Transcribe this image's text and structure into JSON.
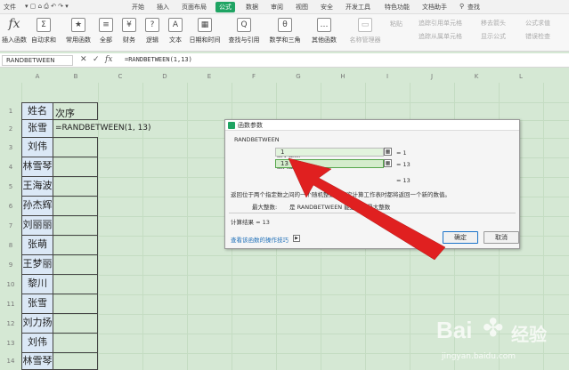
{
  "menu": {
    "file": "文件",
    "items": [
      "开始",
      "插入",
      "页面布局",
      "公式",
      "数据",
      "审阅",
      "视图",
      "安全",
      "开发工具",
      "特色功能",
      "文档助手"
    ],
    "active": "公式",
    "search": "查找"
  },
  "ribbon": {
    "insert_func": "插入函数",
    "autosum": "自动求和",
    "common": "常用函数",
    "all": "全部",
    "finance": "财务",
    "logic": "逻辑",
    "text": "文本",
    "datetime": "日期和时间",
    "lookup": "查找与引用",
    "math": "数学和三角",
    "other": "其他函数",
    "name_mgr": "名称管理器",
    "paste": "粘贴",
    "trace_prec": "追踪引用单元格",
    "trace_dep": "追踪从属单元格",
    "remove_arrows": "移去箭头",
    "show_formula": "显示公式",
    "formula_eval": "公式求值",
    "error_check": "错误检查"
  },
  "formula_bar": {
    "name_box": "RANDBETWEEN",
    "cancel": "✕",
    "confirm": "✓",
    "fx": "fx",
    "content": "=RANDBETWEEN(1,13)"
  },
  "columns": [
    "A",
    "B",
    "C",
    "D",
    "E",
    "F",
    "G",
    "H",
    "I",
    "J",
    "K",
    "L"
  ],
  "rows": [
    "1",
    "2",
    "3",
    "4",
    "5",
    "6",
    "7",
    "8",
    "9",
    "10",
    "11",
    "12",
    "13",
    "14",
    "15"
  ],
  "sheet": {
    "header_a": "姓名",
    "header_b": "次序",
    "b2": "=RANDBETWEEN(1, 13)",
    "names": [
      "张雪",
      "刘伟",
      "林雪琴",
      "王海波",
      "孙杰辉",
      "刘丽丽",
      "张萌",
      "王梦丽",
      "黎川",
      "张雪",
      "刘力扬",
      "刘伟",
      "林雪琴"
    ]
  },
  "dialog": {
    "title": "函数参数",
    "func_name": "RANDBETWEEN",
    "min_label": "最小整数",
    "min_value": "1",
    "min_result": "= 1",
    "max_label": "最大整数",
    "max_value": "13",
    "max_result": "= 13",
    "total": "= 13",
    "desc": "返回位于两个指定数之间的一个随机整数。每次计算工作表时都将返回一个新的数值。",
    "param_desc_label": "最大整数:",
    "param_desc": "是 RANDBETWEEN 能返回的最大整数",
    "calc_result": "计算结果 = 13",
    "help_link": "查看该函数的操作技巧",
    "ok": "确定",
    "cancel": "取消"
  },
  "watermark": {
    "brand": "Bai",
    "brand2": "经验",
    "url": "jingyan.baidu.com"
  },
  "colors": {
    "accent": "#1fa463",
    "arrow": "#e02020",
    "sheet_bg": "#d5e8d4",
    "name_cell": "#dbe8f6"
  }
}
